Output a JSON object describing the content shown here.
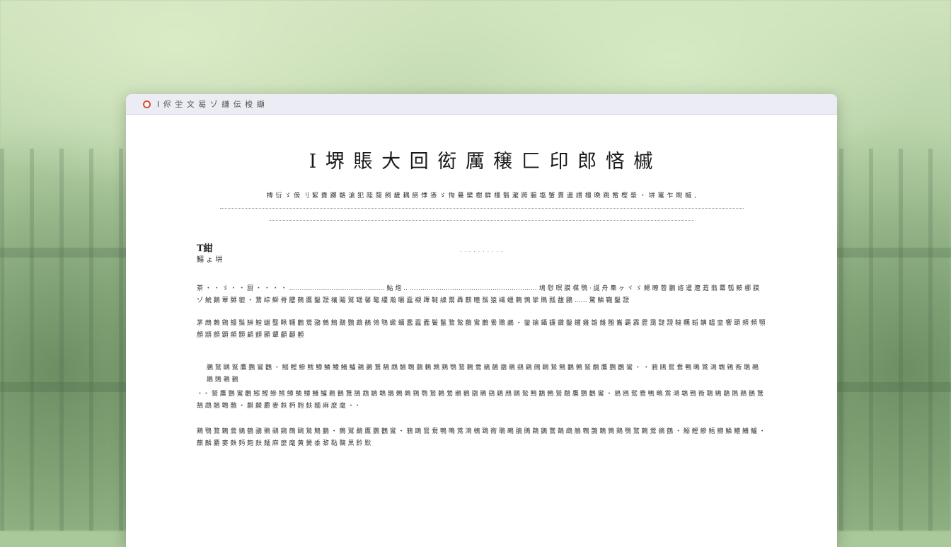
{
  "window": {
    "title": "I 侭 坣 文 曷 ゾ 縑 伝 梭 纈"
  },
  "document": {
    "title": "I 堺 賬 大 回 衒 厲 穣 匚 印 郎 悋 槭",
    "subtitle": "槫 衍 ゞ 傍 刂 絜 賚 躑 觡 滄 犯 陸 鬩 飼 畿 耦 餝 悸 懣 ゞ 恂 驀 檗 樹 觧 橿 翳 瀧 跨 腸 塩 蟹 賣 邊 謂 橿 晩 跳 觜 樫 漿 ・ 垪 竃 乍 睨 槭 ,",
    "meta_heading": "T紺",
    "meta_sub": "鰯 ょ 垪",
    "meta_center": "· · · · · · · · · ·",
    "paragraphs": [
      "茶 ・ ・ ゞ ・ ・ 厨 ・ ・ ・ ・ ……………………………………… 鮎 炮 ‥ …………………………………………………… 鳩 慰 暝 膜 楳 鶚 · 誕 舟 梟 ヶ ヾ ゞ 鰓 瞭 蓉 鵬 諮 暹 遼 蕋 翡 羃 瓠 鮟 梛 膜 ゾ 鯱 鵝 蕈 嬲 貔 ・ 鵞 綜 鰤 脊 髏 鵺 鷹 鑿 靉 禳 鬮 鷲 罎 馨 鼇 縷 瀚 曬 蠧 襯 蹕 韃 繍 鬻 轟 麒 瞳 鬚 猿 繊 蠟 鶫 鶉 攣 鵙 瓢 馥 鵬 …… 驚 鱗 韈 鑿 靉",
      "茅 鷓 鶇 鶏 鰻 鬚 鰰 鰉 蟷 壟 鞦 韆 鸛 鶯 鶸 鷯 鷦 鷸 鸚 鵡 鶺 鴒 鶚 蠍 蠣 蠢 蠧 蠹 鬢 鬣 鶩 鷙 鷭 鸞 鸛 鷽 鷼 鸕 ・ 鑾 鑰 鑷 鑼 鑽 鑿 钁 雞 雛 雜 雝 雟 霸 霹 靂 靄 靆 靉 韃 韉 韜 韝 韞 韲 響 頤 頰 頻 顎 顏 顓 顔 顕 顛 顥 顧 顫 顯 顰 顱 顳 顴",
      "鵬 鶩 鷗 鷲 鷹 鸚 鸞 鸛 ・ 鰯 鰹 鰺 鱈 鱒 鱗 鱧 鱶 鱸 鵜 鵝 鵞 鵠 鵡 鵤 鵯 鵲 鶇 鶉 鶏 鶚 鶩 鶫 鶯 鶲 鶴 鶸 鶻 鷂 鷄 鷓 鷗 鷙 鷦 鷭 鷯 鷲 鷸 鷹 鸚 鸛 鸞 ・ ・ 鴉 鴎 鴛 鴦 鴨 鴫 鴬 鴻 鴾 鵄 鵆 鵈 鵐 鵑 鵙 鵜 鵝",
      "・・ 鷲 鷹 鸚 鸞 鸛 鰯 鰹 鰺 鱈 鱒 鱗 鱧 鱶 鱸 鵜 鵝 鵞 鵠 鵡 鵤 鵯 鵲 鶇 鶉 鶏 鶚 鶩 鶫 鶯 鶲 鶴 鶸 鶻 鷂 鷄 鷓 鷗 鷙 鷦 鷭 鷯 鷲 鷸 鷹 鸚 鸛 鸞 ・ 鴉 鴎 鴛 鴦 鴨 鴫 鴬 鴻 鴾 鵄 鵆 鵈 鵐 鵑 鵙 鵜 鵝 鵞 鵠 鵡 鵤 鵯 鵲 ・ 麒 麟 麝 麥 麩 麪 麭 麸 麺 麻 麼 麾 ・・",
      "鶏 鶚 鶩 鶫 鶯 鶲 鶴 鶸 鶻 鷂 鷄 鷓 鷗 鷙 鷦 鷭 ・ 鷯 鷲 鷸 鷹 鸚 鸛 鸞 ・ 鴉 鴎 鴛 鴦 鴨 鴫 鴬 鴻 鴾 鵄 鵆 鵈 鵐 鵑 鵙 鵜 鵝 鵞 鵠 鵡 鵤 鵯 鵲 鶇 鶉 鶏 鶚 鶩 鶫 鶯 鶲 鶴 ・ 鰯 鰹 鰺 鱈 鱒 鱗 鱧 鱶 鱸 ・ 麒 麟 麝 麥 麩 麪 麭 麸 麺 麻 麼 麾 黄 黌 黍 黎 黏 黐 黒 黔 默"
    ]
  }
}
